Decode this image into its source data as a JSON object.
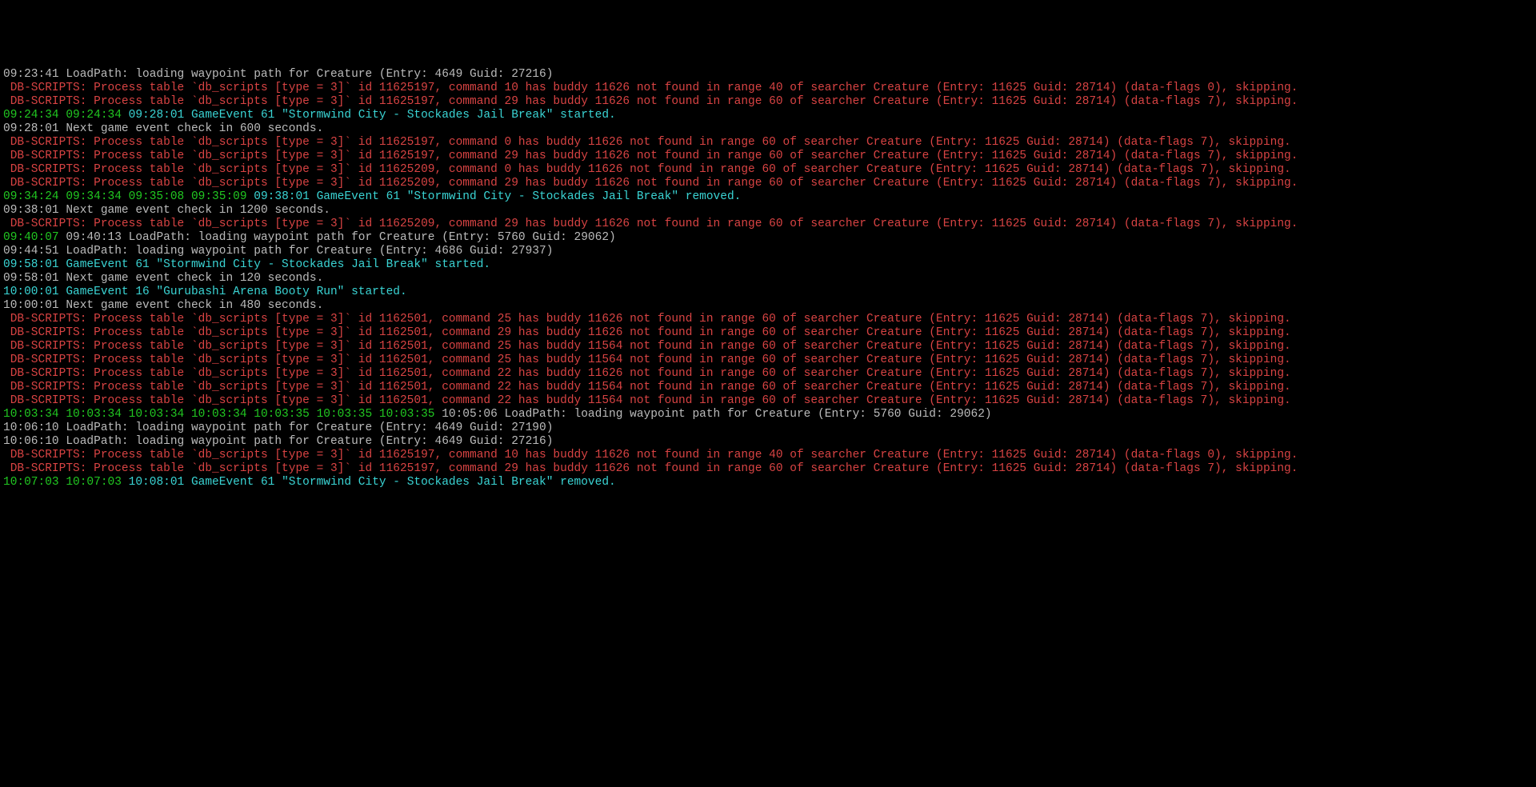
{
  "lines": [
    {
      "segments": [
        {
          "c": "gray",
          "t": "09:23:41 LoadPath: loading waypoint path for Creature (Entry: 4649 Guid: 27216)"
        }
      ]
    },
    {
      "segments": [
        {
          "c": "red",
          "t": " DB-SCRIPTS: Process table `db_scripts [type = 3]` id 11625197, command 10 has buddy 11626 not found in range 40 of searcher Creature (Entry: 11625 Guid: 28714) (data-flags 0), skipping."
        }
      ]
    },
    {
      "segments": [
        {
          "c": "red",
          "t": " DB-SCRIPTS: Process table `db_scripts [type = 3]` id 11625197, command 29 has buddy 11626 not found in range 60 of searcher Creature (Entry: 11625 Guid: 28714) (data-flags 7), skipping."
        }
      ]
    },
    {
      "segments": [
        {
          "c": "green",
          "t": "09:24:34 09:24:34 "
        },
        {
          "c": "cyan",
          "t": "09:28:01 GameEvent 61 \"Stormwind City - Stockades Jail Break\" started."
        }
      ]
    },
    {
      "segments": [
        {
          "c": "gray",
          "t": "09:28:01 Next game event check in 600 seconds."
        }
      ]
    },
    {
      "segments": [
        {
          "c": "red",
          "t": " DB-SCRIPTS: Process table `db_scripts [type = 3]` id 11625197, command 0 has buddy 11626 not found in range 60 of searcher Creature (Entry: 11625 Guid: 28714) (data-flags 7), skipping."
        }
      ]
    },
    {
      "segments": [
        {
          "c": "red",
          "t": " DB-SCRIPTS: Process table `db_scripts [type = 3]` id 11625197, command 29 has buddy 11626 not found in range 60 of searcher Creature (Entry: 11625 Guid: 28714) (data-flags 7), skipping."
        }
      ]
    },
    {
      "segments": [
        {
          "c": "red",
          "t": " DB-SCRIPTS: Process table `db_scripts [type = 3]` id 11625209, command 0 has buddy 11626 not found in range 60 of searcher Creature (Entry: 11625 Guid: 28714) (data-flags 7), skipping."
        }
      ]
    },
    {
      "segments": [
        {
          "c": "red",
          "t": " DB-SCRIPTS: Process table `db_scripts [type = 3]` id 11625209, command 29 has buddy 11626 not found in range 60 of searcher Creature (Entry: 11625 Guid: 28714) (data-flags 7), skipping."
        }
      ]
    },
    {
      "segments": [
        {
          "c": "green",
          "t": "09:34:24 09:34:34 09:35:08 09:35:09 "
        },
        {
          "c": "cyan",
          "t": "09:38:01 GameEvent 61 \"Stormwind City - Stockades Jail Break\" removed."
        }
      ]
    },
    {
      "segments": [
        {
          "c": "gray",
          "t": "09:38:01 Next game event check in 1200 seconds."
        }
      ]
    },
    {
      "segments": [
        {
          "c": "red",
          "t": " DB-SCRIPTS: Process table `db_scripts [type = 3]` id 11625209, command 29 has buddy 11626 not found in range 60 of searcher Creature (Entry: 11625 Guid: 28714) (data-flags 7), skipping."
        }
      ]
    },
    {
      "segments": [
        {
          "c": "green",
          "t": "09:40:07 "
        },
        {
          "c": "gray",
          "t": "09:40:13 LoadPath: loading waypoint path for Creature (Entry: 5760 Guid: 29062)"
        }
      ]
    },
    {
      "segments": [
        {
          "c": "gray",
          "t": "09:44:51 LoadPath: loading waypoint path for Creature (Entry: 4686 Guid: 27937)"
        }
      ]
    },
    {
      "segments": [
        {
          "c": "cyan",
          "t": "09:58:01 GameEvent 61 \"Stormwind City - Stockades Jail Break\" started."
        }
      ]
    },
    {
      "segments": [
        {
          "c": "gray",
          "t": "09:58:01 Next game event check in 120 seconds."
        }
      ]
    },
    {
      "segments": [
        {
          "c": "cyan",
          "t": "10:00:01 GameEvent 16 \"Gurubashi Arena Booty Run\" started."
        }
      ]
    },
    {
      "segments": [
        {
          "c": "gray",
          "t": "10:00:01 Next game event check in 480 seconds."
        }
      ]
    },
    {
      "segments": [
        {
          "c": "red",
          "t": " DB-SCRIPTS: Process table `db_scripts [type = 3]` id 1162501, command 25 has buddy 11626 not found in range 60 of searcher Creature (Entry: 11625 Guid: 28714) (data-flags 7), skipping."
        }
      ]
    },
    {
      "segments": [
        {
          "c": "red",
          "t": " DB-SCRIPTS: Process table `db_scripts [type = 3]` id 1162501, command 29 has buddy 11626 not found in range 60 of searcher Creature (Entry: 11625 Guid: 28714) (data-flags 7), skipping."
        }
      ]
    },
    {
      "segments": [
        {
          "c": "red",
          "t": " DB-SCRIPTS: Process table `db_scripts [type = 3]` id 1162501, command 25 has buddy 11564 not found in range 60 of searcher Creature (Entry: 11625 Guid: 28714) (data-flags 7), skipping."
        }
      ]
    },
    {
      "segments": [
        {
          "c": "red",
          "t": " DB-SCRIPTS: Process table `db_scripts [type = 3]` id 1162501, command 25 has buddy 11564 not found in range 60 of searcher Creature (Entry: 11625 Guid: 28714) (data-flags 7), skipping."
        }
      ]
    },
    {
      "segments": [
        {
          "c": "red",
          "t": " DB-SCRIPTS: Process table `db_scripts [type = 3]` id 1162501, command 22 has buddy 11626 not found in range 60 of searcher Creature (Entry: 11625 Guid: 28714) (data-flags 7), skipping."
        }
      ]
    },
    {
      "segments": [
        {
          "c": "red",
          "t": " DB-SCRIPTS: Process table `db_scripts [type = 3]` id 1162501, command 22 has buddy 11564 not found in range 60 of searcher Creature (Entry: 11625 Guid: 28714) (data-flags 7), skipping."
        }
      ]
    },
    {
      "segments": [
        {
          "c": "red",
          "t": " DB-SCRIPTS: Process table `db_scripts [type = 3]` id 1162501, command 22 has buddy 11564 not found in range 60 of searcher Creature (Entry: 11625 Guid: 28714) (data-flags 7), skipping."
        }
      ]
    },
    {
      "segments": [
        {
          "c": "green",
          "t": "10:03:34 10:03:34 10:03:34 10:03:34 10:03:35 10:03:35 10:03:35 "
        },
        {
          "c": "gray",
          "t": "10:05:06 LoadPath: loading waypoint path for Creature (Entry: 5760 Guid: 29062)"
        }
      ]
    },
    {
      "segments": [
        {
          "c": "gray",
          "t": "10:06:10 LoadPath: loading waypoint path for Creature (Entry: 4649 Guid: 27190)"
        }
      ]
    },
    {
      "segments": [
        {
          "c": "gray",
          "t": "10:06:10 LoadPath: loading waypoint path for Creature (Entry: 4649 Guid: 27216)"
        }
      ]
    },
    {
      "segments": [
        {
          "c": "red",
          "t": " DB-SCRIPTS: Process table `db_scripts [type = 3]` id 11625197, command 10 has buddy 11626 not found in range 40 of searcher Creature (Entry: 11625 Guid: 28714) (data-flags 0), skipping."
        }
      ]
    },
    {
      "segments": [
        {
          "c": "red",
          "t": " DB-SCRIPTS: Process table `db_scripts [type = 3]` id 11625197, command 29 has buddy 11626 not found in range 60 of searcher Creature (Entry: 11625 Guid: 28714) (data-flags 7), skipping."
        }
      ]
    },
    {
      "segments": [
        {
          "c": "green",
          "t": "10:07:03 10:07:03 "
        },
        {
          "c": "cyan",
          "t": "10:08:01 GameEvent 61 \"Stormwind City - Stockades Jail Break\" removed."
        }
      ]
    }
  ]
}
